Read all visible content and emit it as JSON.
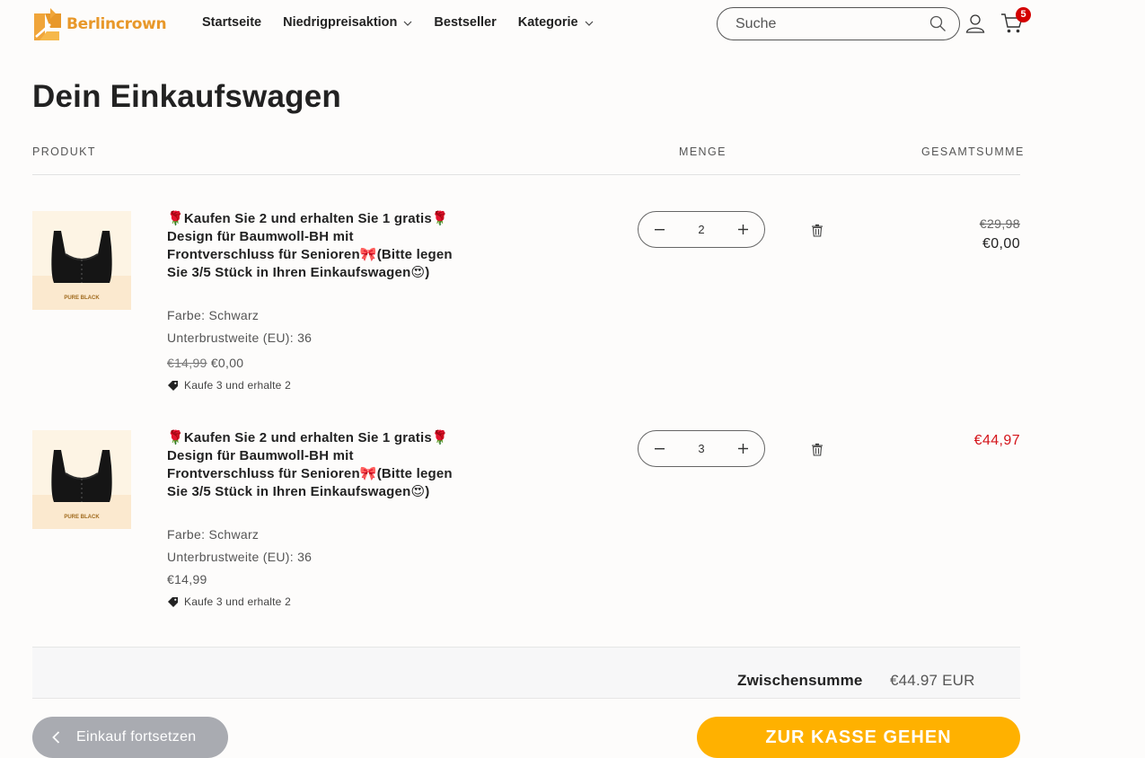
{
  "brand": {
    "name": "Berlincrown",
    "accent": "#e8982a"
  },
  "nav": {
    "items": [
      {
        "label": "Startseite",
        "dropdown": false
      },
      {
        "label": "Niedrigpreisaktion",
        "dropdown": true
      },
      {
        "label": "Bestseller",
        "dropdown": false
      },
      {
        "label": "Kategorie",
        "dropdown": true
      }
    ]
  },
  "search": {
    "placeholder": "Suche",
    "icon": "search-icon"
  },
  "account": {
    "icon": "user-icon"
  },
  "cart_icon": {
    "icon": "cart-icon",
    "count": "5",
    "badge_color": "#d40000"
  },
  "cart": {
    "title": "Dein Einkaufswagen",
    "columns": {
      "product": "PRODUKT",
      "quantity": "MENGE",
      "total": "GESAMTSUMME"
    },
    "items": [
      {
        "title": "🌹Kaufen Sie 2 und erhalten Sie 1 gratis🌹Design für Baumwoll-BH mit Frontverschluss für Senioren🎀(Bitte legen Sie 3/5 Stück in Ihren Einkaufswagen😍)",
        "image_label": "PURE BLACK",
        "color": "Farbe: Schwarz",
        "size": "Unterbrustweite (EU): 36",
        "price_old": "€14,99",
        "price": "€0,00",
        "promo": "Kaufe 3 und erhalte 2",
        "quantity": "2",
        "total_old": "€29,98",
        "total": "€0,00"
      },
      {
        "title": "🌹Kaufen Sie 2 und erhalten Sie 1 gratis🌹Design für Baumwoll-BH mit Frontverschluss für Senioren🎀(Bitte legen Sie 3/5 Stück in Ihren Einkaufswagen😍)",
        "image_label": "PURE BLACK",
        "color": "Farbe: Schwarz",
        "size": "Unterbrustweite (EU): 36",
        "price": "€14,99",
        "promo": "Kaufe 3 und erhalte 2",
        "quantity": "3",
        "total": "€44,97",
        "total_color": "#d4141a"
      }
    ],
    "subtotal_label": "Zwischensumme",
    "subtotal_value": "€44.97 EUR",
    "continue_label": "Einkauf fortsetzen",
    "checkout_label": "ZUR KASSE GEHEN",
    "checkout_color": "#ffb100"
  }
}
